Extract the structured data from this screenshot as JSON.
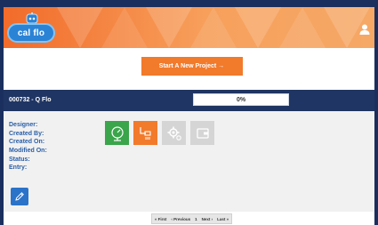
{
  "header": {
    "logo_text": "cal flo",
    "user_icon": "user-icon"
  },
  "cta": {
    "label": "Start A New Project →"
  },
  "project": {
    "title": "000732 - Q Flo",
    "progress_label": "0%",
    "progress_value": 0,
    "fields": [
      {
        "label": "Designer:"
      },
      {
        "label": "Created By:"
      },
      {
        "label": "Created On:"
      },
      {
        "label": "Modified On:"
      },
      {
        "label": "Status:"
      },
      {
        "label": "Entry:"
      }
    ],
    "tiles": [
      {
        "icon": "gauge-icon",
        "color": "#3aa54a"
      },
      {
        "icon": "shower-icon",
        "color": "#f27a2b"
      },
      {
        "icon": "settings-icon",
        "color": "#d5d5d5"
      },
      {
        "icon": "wallet-icon",
        "color": "#d5d5d5"
      }
    ],
    "edit_icon": "pencil-icon"
  },
  "pager": {
    "first": "« First",
    "previous": "‹ Previous",
    "page": "1",
    "next": "Next ›",
    "last": "Last »"
  },
  "colors": {
    "frame": "#1b2f5e",
    "accent": "#f27a2b",
    "project_bar": "#1f3563",
    "field_label": "#2a5fa8"
  }
}
